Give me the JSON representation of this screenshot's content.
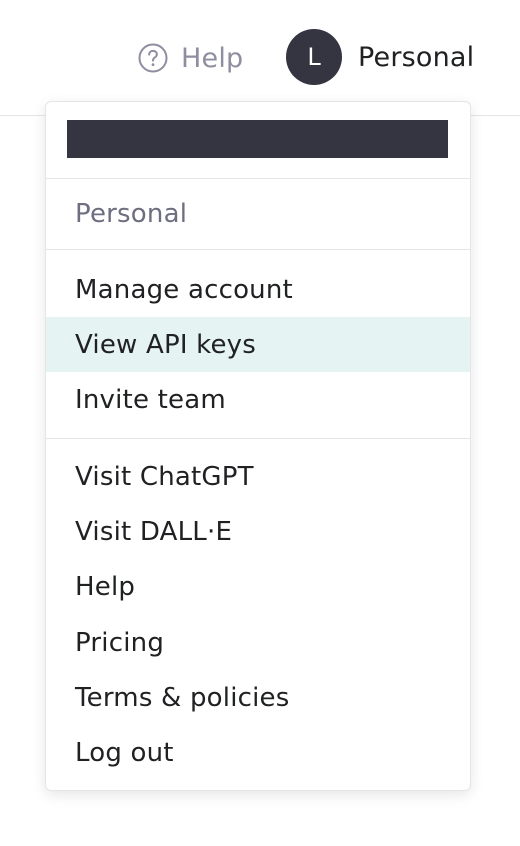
{
  "header": {
    "help_label": "Help",
    "account": {
      "avatar_initial": "L",
      "name": "Personal"
    }
  },
  "menu": {
    "organization_label": "Personal",
    "account_items": [
      {
        "label": "Manage account"
      },
      {
        "label": "View API keys",
        "active": true
      },
      {
        "label": "Invite team"
      }
    ],
    "links": [
      {
        "label": "Visit ChatGPT"
      },
      {
        "label": "Visit DALL·E"
      },
      {
        "label": "Help"
      },
      {
        "label": "Pricing"
      },
      {
        "label": "Terms & policies"
      },
      {
        "label": "Log out"
      }
    ]
  },
  "colors": {
    "avatar_bg": "#343541",
    "active_item_bg": "#e6f3f3",
    "muted_text": "#8e8ea0"
  },
  "icons": {
    "help": "question-circle-icon"
  }
}
